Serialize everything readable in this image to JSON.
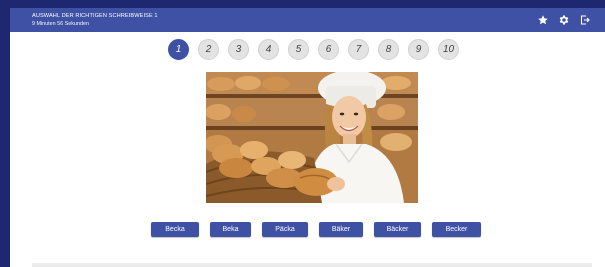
{
  "header": {
    "title": "AUSWAHL DER RICHTIGEN SCHREIBWEISE 1",
    "timer": "9 Minuten 56 Sekunden",
    "icons": [
      "star-icon",
      "gear-icon",
      "exit-icon"
    ]
  },
  "pager": {
    "pages": [
      "1",
      "2",
      "3",
      "4",
      "5",
      "6",
      "7",
      "8",
      "9",
      "10"
    ],
    "active": "1"
  },
  "image": {
    "subject": "baker holding basket of bread"
  },
  "answers": [
    "Becka",
    "Beka",
    "Päcka",
    "Bäker",
    "Bäcker",
    "Becker"
  ],
  "colors": {
    "accent": "#3f51a5",
    "frame": "#1d2870",
    "page_inactive": "#e3e3e3"
  }
}
